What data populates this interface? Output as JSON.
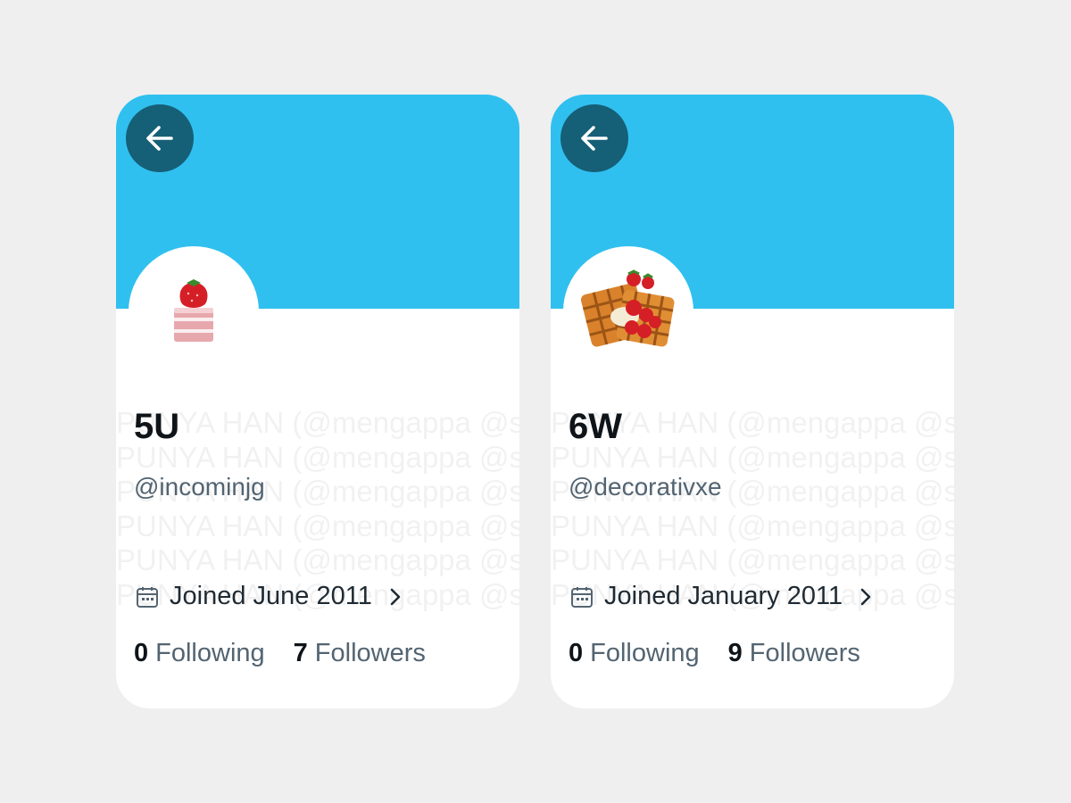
{
  "watermark": {
    "line": "PUNYA HAN (@mengappa @sourcxes @lovxeliest @fciend)",
    "repeat": 6
  },
  "colors": {
    "banner": "#30c0ef",
    "back_button": "#155f77",
    "background": "#efefef"
  },
  "profiles": [
    {
      "back_icon": "arrow-left-icon",
      "avatar_icon": "strawberry-cake-emoji",
      "name": "5U",
      "handle": "@incominjg",
      "calendar_icon": "calendar-icon",
      "joined": "Joined June 2011",
      "chevron_icon": "chevron-right-icon",
      "following_count": "0",
      "following_label": "Following",
      "followers_count": "7",
      "followers_label": "Followers"
    },
    {
      "back_icon": "arrow-left-icon",
      "avatar_icon": "strawberry-waffle-emoji",
      "name": "6W",
      "handle": "@decorativxe",
      "calendar_icon": "calendar-icon",
      "joined": "Joined January 2011",
      "chevron_icon": "chevron-right-icon",
      "following_count": "0",
      "following_label": "Following",
      "followers_count": "9",
      "followers_label": "Followers"
    }
  ]
}
